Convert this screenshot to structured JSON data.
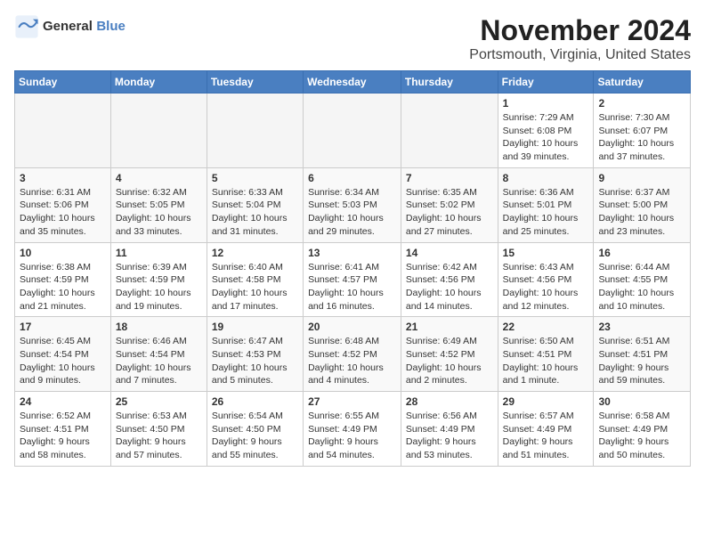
{
  "logo": {
    "general": "General",
    "blue": "Blue"
  },
  "title": "November 2024",
  "subtitle": "Portsmouth, Virginia, United States",
  "weekdays": [
    "Sunday",
    "Monday",
    "Tuesday",
    "Wednesday",
    "Thursday",
    "Friday",
    "Saturday"
  ],
  "weeks": [
    [
      {
        "day": "",
        "info": ""
      },
      {
        "day": "",
        "info": ""
      },
      {
        "day": "",
        "info": ""
      },
      {
        "day": "",
        "info": ""
      },
      {
        "day": "",
        "info": ""
      },
      {
        "day": "1",
        "info": "Sunrise: 7:29 AM\nSunset: 6:08 PM\nDaylight: 10 hours\nand 39 minutes."
      },
      {
        "day": "2",
        "info": "Sunrise: 7:30 AM\nSunset: 6:07 PM\nDaylight: 10 hours\nand 37 minutes."
      }
    ],
    [
      {
        "day": "3",
        "info": "Sunrise: 6:31 AM\nSunset: 5:06 PM\nDaylight: 10 hours\nand 35 minutes."
      },
      {
        "day": "4",
        "info": "Sunrise: 6:32 AM\nSunset: 5:05 PM\nDaylight: 10 hours\nand 33 minutes."
      },
      {
        "day": "5",
        "info": "Sunrise: 6:33 AM\nSunset: 5:04 PM\nDaylight: 10 hours\nand 31 minutes."
      },
      {
        "day": "6",
        "info": "Sunrise: 6:34 AM\nSunset: 5:03 PM\nDaylight: 10 hours\nand 29 minutes."
      },
      {
        "day": "7",
        "info": "Sunrise: 6:35 AM\nSunset: 5:02 PM\nDaylight: 10 hours\nand 27 minutes."
      },
      {
        "day": "8",
        "info": "Sunrise: 6:36 AM\nSunset: 5:01 PM\nDaylight: 10 hours\nand 25 minutes."
      },
      {
        "day": "9",
        "info": "Sunrise: 6:37 AM\nSunset: 5:00 PM\nDaylight: 10 hours\nand 23 minutes."
      }
    ],
    [
      {
        "day": "10",
        "info": "Sunrise: 6:38 AM\nSunset: 4:59 PM\nDaylight: 10 hours\nand 21 minutes."
      },
      {
        "day": "11",
        "info": "Sunrise: 6:39 AM\nSunset: 4:59 PM\nDaylight: 10 hours\nand 19 minutes."
      },
      {
        "day": "12",
        "info": "Sunrise: 6:40 AM\nSunset: 4:58 PM\nDaylight: 10 hours\nand 17 minutes."
      },
      {
        "day": "13",
        "info": "Sunrise: 6:41 AM\nSunset: 4:57 PM\nDaylight: 10 hours\nand 16 minutes."
      },
      {
        "day": "14",
        "info": "Sunrise: 6:42 AM\nSunset: 4:56 PM\nDaylight: 10 hours\nand 14 minutes."
      },
      {
        "day": "15",
        "info": "Sunrise: 6:43 AM\nSunset: 4:56 PM\nDaylight: 10 hours\nand 12 minutes."
      },
      {
        "day": "16",
        "info": "Sunrise: 6:44 AM\nSunset: 4:55 PM\nDaylight: 10 hours\nand 10 minutes."
      }
    ],
    [
      {
        "day": "17",
        "info": "Sunrise: 6:45 AM\nSunset: 4:54 PM\nDaylight: 10 hours\nand 9 minutes."
      },
      {
        "day": "18",
        "info": "Sunrise: 6:46 AM\nSunset: 4:54 PM\nDaylight: 10 hours\nand 7 minutes."
      },
      {
        "day": "19",
        "info": "Sunrise: 6:47 AM\nSunset: 4:53 PM\nDaylight: 10 hours\nand 5 minutes."
      },
      {
        "day": "20",
        "info": "Sunrise: 6:48 AM\nSunset: 4:52 PM\nDaylight: 10 hours\nand 4 minutes."
      },
      {
        "day": "21",
        "info": "Sunrise: 6:49 AM\nSunset: 4:52 PM\nDaylight: 10 hours\nand 2 minutes."
      },
      {
        "day": "22",
        "info": "Sunrise: 6:50 AM\nSunset: 4:51 PM\nDaylight: 10 hours\nand 1 minute."
      },
      {
        "day": "23",
        "info": "Sunrise: 6:51 AM\nSunset: 4:51 PM\nDaylight: 9 hours\nand 59 minutes."
      }
    ],
    [
      {
        "day": "24",
        "info": "Sunrise: 6:52 AM\nSunset: 4:51 PM\nDaylight: 9 hours\nand 58 minutes."
      },
      {
        "day": "25",
        "info": "Sunrise: 6:53 AM\nSunset: 4:50 PM\nDaylight: 9 hours\nand 57 minutes."
      },
      {
        "day": "26",
        "info": "Sunrise: 6:54 AM\nSunset: 4:50 PM\nDaylight: 9 hours\nand 55 minutes."
      },
      {
        "day": "27",
        "info": "Sunrise: 6:55 AM\nSunset: 4:49 PM\nDaylight: 9 hours\nand 54 minutes."
      },
      {
        "day": "28",
        "info": "Sunrise: 6:56 AM\nSunset: 4:49 PM\nDaylight: 9 hours\nand 53 minutes."
      },
      {
        "day": "29",
        "info": "Sunrise: 6:57 AM\nSunset: 4:49 PM\nDaylight: 9 hours\nand 51 minutes."
      },
      {
        "day": "30",
        "info": "Sunrise: 6:58 AM\nSunset: 4:49 PM\nDaylight: 9 hours\nand 50 minutes."
      }
    ]
  ]
}
